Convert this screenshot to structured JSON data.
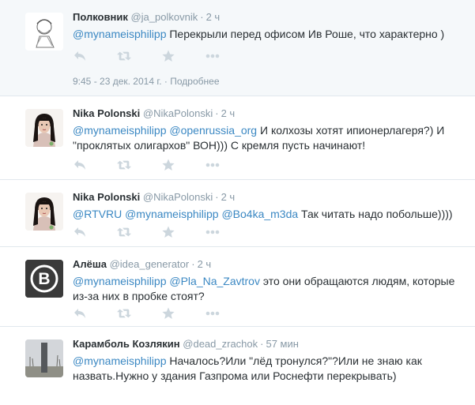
{
  "tweets": [
    {
      "fullname": "Полковник",
      "username": "@ja_polkovnik",
      "time": "2 ч",
      "lines": [
        [
          {
            "t": "@mynameisphilipp",
            "m": true
          },
          {
            "t": " Перекрыли перед офисом Ив Роше, что характерно )",
            "m": false
          }
        ]
      ],
      "meta": {
        "datetime": "9:45 - 23 дек. 2014 г.",
        "separator": "·",
        "details_link": "Подробнее"
      }
    },
    {
      "fullname": "Nika Polonski",
      "username": "@NikaPolonski",
      "time": "2 ч",
      "lines": [
        [
          {
            "t": "@mynameisphilipp",
            "m": true
          },
          {
            "t": " ",
            "m": false
          },
          {
            "t": "@openrussia_org",
            "m": true
          },
          {
            "t": " И колхозы хотят ипионерлагеря?) И",
            "m": false
          }
        ],
        [
          {
            "t": "\"проклятых олигархов\" ВОН))) С кремля пусть начинают!",
            "m": false
          }
        ]
      ]
    },
    {
      "fullname": "Nika Polonski",
      "username": "@NikaPolonski",
      "time": "2 ч",
      "lines": [
        [
          {
            "t": "@RTVRU",
            "m": true
          },
          {
            "t": " ",
            "m": false
          },
          {
            "t": "@mynameisphilipp",
            "m": true
          },
          {
            "t": " ",
            "m": false
          },
          {
            "t": "@Bo4ka_m3da",
            "m": true
          },
          {
            "t": " Так читать надо побольше))))",
            "m": false
          }
        ]
      ]
    },
    {
      "fullname": "Алёша",
      "username": "@idea_generator",
      "time": "2 ч",
      "lines": [
        [
          {
            "t": "@mynameisphilipp",
            "m": true
          },
          {
            "t": " ",
            "m": false
          },
          {
            "t": "@Pla_Na_Zavtrov",
            "m": true
          },
          {
            "t": " это они обращаются людям, которые",
            "m": false
          }
        ],
        [
          {
            "t": "из-за них в пробке стоят?",
            "m": false
          }
        ]
      ]
    },
    {
      "fullname": "Карамболь Козлякин",
      "username": "@dead_zrachok",
      "time": "57 мин",
      "lines": [
        [
          {
            "t": "@mynameisphilipp",
            "m": true
          },
          {
            "t": " Началось?Или \"лёд тронулся?\"?Или не знаю как",
            "m": false
          }
        ],
        [
          {
            "t": "назвать.Нужно у здания Газпрома или Роснефти перекрывать)",
            "m": false
          }
        ]
      ]
    }
  ],
  "separator": "·",
  "icons": {
    "reply": "reply-icon",
    "retweet": "retweet-icon",
    "favorite": "star-icon",
    "more": "more-icon"
  },
  "colors": {
    "mention": "#3b88c3",
    "muted": "#8899a6",
    "icon": "#ccd6dd",
    "border": "#e1e8ed",
    "highlight_bg": "#f5f8fa"
  }
}
